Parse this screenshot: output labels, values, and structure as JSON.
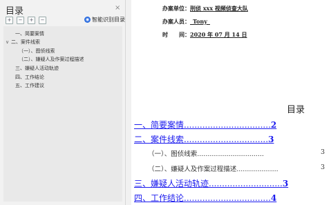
{
  "nav_panel": {
    "title": "目录",
    "close_label": "×",
    "toolbar": [
      "+",
      "−",
      "+",
      "−"
    ],
    "smart_button": "智能识别目录",
    "items": [
      {
        "label": "一、简要案情",
        "caret": ""
      },
      {
        "label": "二、案件线索",
        "caret": "∨"
      },
      {
        "label": "（一）、图侦线索",
        "caret": ""
      },
      {
        "label": "（二）、嫌疑人及作案过程描述",
        "caret": ""
      },
      {
        "label": "三、嫌疑人活动轨迹",
        "caret": ""
      },
      {
        "label": "四、工作结论",
        "caret": ""
      },
      {
        "label": "五、工作建议",
        "caret": ""
      }
    ]
  },
  "document": {
    "fields": [
      {
        "label": "办案单位：",
        "value": "刑侦 xxx 视频侦查大队"
      },
      {
        "label": "办案人员：",
        "value": "_Tony_"
      },
      {
        "label": "时　　间：",
        "value": "2020 年 07 月 14 日"
      }
    ],
    "toc_title": "目录",
    "toc": [
      {
        "text": "一、简要案情.................................",
        "page": "2"
      },
      {
        "text": "二、案件线索................................",
        "page": "3"
      },
      {
        "text": "（一）、图侦线索................................",
        "page": "3"
      },
      {
        "text": "（二）、嫌疑人及作案过程描述....................",
        "page": "3"
      },
      {
        "text": "三、嫌疑人活动轨迹............................",
        "page": "3"
      },
      {
        "text": "四、工作结论.................................",
        "page": "4"
      }
    ]
  }
}
